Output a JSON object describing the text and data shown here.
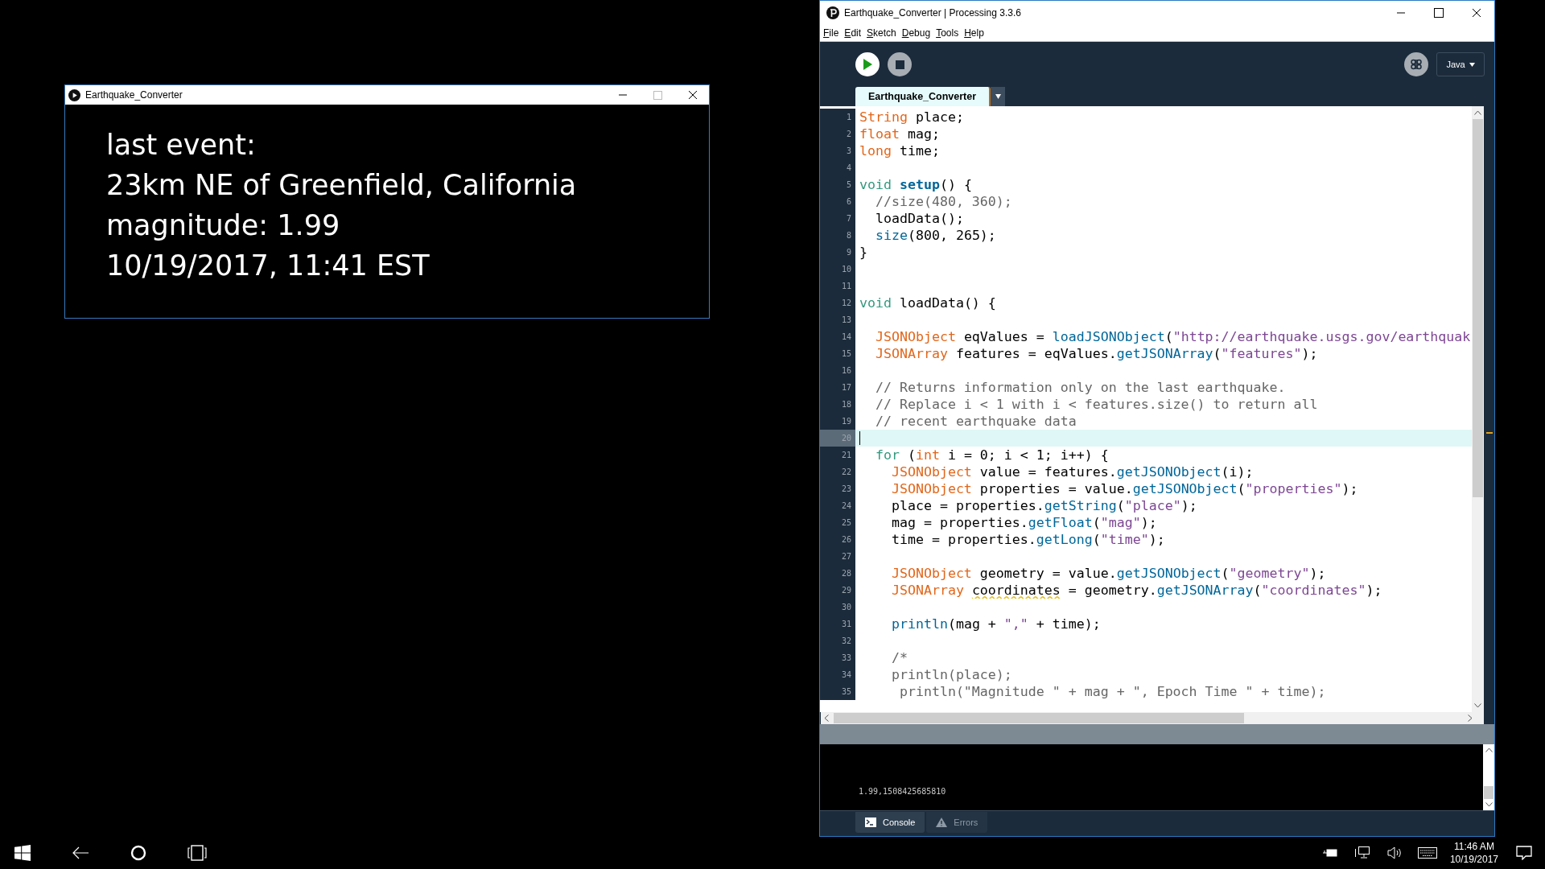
{
  "sketch_window": {
    "title": "Earthquake_Converter",
    "lines": [
      "last event:",
      "23km NE of Greenfield, California",
      "magnitude: 1.99",
      "10/19/2017, 11:41 EST"
    ]
  },
  "ide_window": {
    "title": "Earthquake_Converter | Processing 3.3.6",
    "menu": [
      "File",
      "Edit",
      "Sketch",
      "Debug",
      "Tools",
      "Help"
    ],
    "mode": "Java",
    "tabs": [
      {
        "label": "Earthquake_Converter",
        "selected": true
      }
    ],
    "code": [
      {
        "number": "1",
        "current": false,
        "tokens": [
          {
            "kind": "type",
            "text": "String"
          },
          {
            "kind": "plain",
            "text": " place;"
          }
        ]
      },
      {
        "number": "2",
        "current": false,
        "tokens": [
          {
            "kind": "type",
            "text": "float"
          },
          {
            "kind": "plain",
            "text": " mag;"
          }
        ]
      },
      {
        "number": "3",
        "current": false,
        "tokens": [
          {
            "kind": "type",
            "text": "long"
          },
          {
            "kind": "plain",
            "text": " time;"
          }
        ]
      },
      {
        "number": "4",
        "current": false
      },
      {
        "number": "5",
        "current": false,
        "tokens": [
          {
            "kind": "keyword",
            "text": "void "
          },
          {
            "kind": "function-bold",
            "text": "setup"
          },
          {
            "kind": "plain",
            "text": "() {"
          }
        ]
      },
      {
        "number": "6",
        "current": false,
        "tokens": [
          {
            "kind": "comment",
            "text": "  //size(480, 360);"
          }
        ]
      },
      {
        "number": "7",
        "current": false,
        "tokens": [
          {
            "kind": "plain",
            "text": "  loadData();"
          }
        ]
      },
      {
        "number": "8",
        "current": false,
        "tokens": [
          {
            "kind": "function",
            "text": "  size"
          },
          {
            "kind": "plain",
            "text": "(800, 265);"
          }
        ]
      },
      {
        "number": "9",
        "current": false,
        "tokens": [
          {
            "kind": "plain",
            "text": "}"
          }
        ]
      },
      {
        "number": "10",
        "current": false
      },
      {
        "number": "11",
        "current": false
      },
      {
        "number": "12",
        "current": false,
        "tokens": [
          {
            "kind": "keyword",
            "text": "void"
          },
          {
            "kind": "plain",
            "text": " loadData() {"
          }
        ]
      },
      {
        "number": "13",
        "current": false
      },
      {
        "number": "14",
        "current": false,
        "tokens": [
          {
            "kind": "type",
            "text": "  JSONObject"
          },
          {
            "kind": "plain",
            "text": " eqValues = "
          },
          {
            "kind": "function",
            "text": "loadJSONObject"
          },
          {
            "kind": "plain",
            "text": "("
          },
          {
            "kind": "string",
            "text": "\"http://earthquake.usgs.gov/earthquak"
          }
        ]
      },
      {
        "number": "15",
        "current": false,
        "tokens": [
          {
            "kind": "type",
            "text": "  JSONArray"
          },
          {
            "kind": "plain",
            "text": " features = eqValues."
          },
          {
            "kind": "function",
            "text": "getJSONArray"
          },
          {
            "kind": "plain",
            "text": "("
          },
          {
            "kind": "string",
            "text": "\"features\""
          },
          {
            "kind": "plain",
            "text": ");"
          }
        ]
      },
      {
        "number": "16",
        "current": false
      },
      {
        "number": "17",
        "current": false,
        "tokens": [
          {
            "kind": "comment",
            "text": "  // Returns information only on the last earthquake."
          }
        ]
      },
      {
        "number": "18",
        "current": false,
        "tokens": [
          {
            "kind": "comment",
            "text": "  // Replace i < 1 with i < features.size() to return all"
          }
        ]
      },
      {
        "number": "19",
        "current": false,
        "tokens": [
          {
            "kind": "comment",
            "text": "  // recent earthquake data"
          }
        ]
      },
      {
        "number": "20",
        "current": true
      },
      {
        "number": "21",
        "current": false,
        "tokens": [
          {
            "kind": "keyword",
            "text": "  for"
          },
          {
            "kind": "plain",
            "text": " ("
          },
          {
            "kind": "type",
            "text": "int"
          },
          {
            "kind": "plain",
            "text": " i = 0; i < 1; i++) {"
          }
        ]
      },
      {
        "number": "22",
        "current": false,
        "tokens": [
          {
            "kind": "type",
            "text": "    JSONObject"
          },
          {
            "kind": "plain",
            "text": " value = features."
          },
          {
            "kind": "function",
            "text": "getJSONObject"
          },
          {
            "kind": "plain",
            "text": "(i);"
          }
        ]
      },
      {
        "number": "23",
        "current": false,
        "tokens": [
          {
            "kind": "type",
            "text": "    JSONObject"
          },
          {
            "kind": "plain",
            "text": " properties = value."
          },
          {
            "kind": "function",
            "text": "getJSONObject"
          },
          {
            "kind": "plain",
            "text": "("
          },
          {
            "kind": "string",
            "text": "\"properties\""
          },
          {
            "kind": "plain",
            "text": ");"
          }
        ]
      },
      {
        "number": "24",
        "current": false,
        "tokens": [
          {
            "kind": "plain",
            "text": "    place = properties."
          },
          {
            "kind": "function",
            "text": "getString"
          },
          {
            "kind": "plain",
            "text": "("
          },
          {
            "kind": "string",
            "text": "\"place\""
          },
          {
            "kind": "plain",
            "text": ");"
          }
        ]
      },
      {
        "number": "25",
        "current": false,
        "tokens": [
          {
            "kind": "plain",
            "text": "    mag = properties."
          },
          {
            "kind": "function",
            "text": "getFloat"
          },
          {
            "kind": "plain",
            "text": "("
          },
          {
            "kind": "string",
            "text": "\"mag\""
          },
          {
            "kind": "plain",
            "text": ");"
          }
        ]
      },
      {
        "number": "26",
        "current": false,
        "tokens": [
          {
            "kind": "plain",
            "text": "    time = properties."
          },
          {
            "kind": "function",
            "text": "getLong"
          },
          {
            "kind": "plain",
            "text": "("
          },
          {
            "kind": "string",
            "text": "\"time\""
          },
          {
            "kind": "plain",
            "text": ");"
          }
        ]
      },
      {
        "number": "27",
        "current": false
      },
      {
        "number": "28",
        "current": false,
        "tokens": [
          {
            "kind": "type",
            "text": "    JSONObject"
          },
          {
            "kind": "plain",
            "text": " geometry = value."
          },
          {
            "kind": "function",
            "text": "getJSONObject"
          },
          {
            "kind": "plain",
            "text": "("
          },
          {
            "kind": "string",
            "text": "\"geometry\""
          },
          {
            "kind": "plain",
            "text": ");"
          }
        ]
      },
      {
        "number": "29",
        "current": false,
        "tokens": [
          {
            "kind": "type",
            "text": "    JSONArray "
          },
          {
            "kind": "warning",
            "text": "coordinates"
          },
          {
            "kind": "plain",
            "text": " = geometry."
          },
          {
            "kind": "function",
            "text": "getJSONArray"
          },
          {
            "kind": "plain",
            "text": "("
          },
          {
            "kind": "string",
            "text": "\"coordinates\""
          },
          {
            "kind": "plain",
            "text": ");"
          }
        ]
      },
      {
        "number": "30",
        "current": false
      },
      {
        "number": "31",
        "current": false,
        "tokens": [
          {
            "kind": "function",
            "text": "    println"
          },
          {
            "kind": "plain",
            "text": "(mag + "
          },
          {
            "kind": "string",
            "text": "\",\""
          },
          {
            "kind": "plain",
            "text": " + time);"
          }
        ]
      },
      {
        "number": "32",
        "current": false
      },
      {
        "number": "33",
        "current": false,
        "tokens": [
          {
            "kind": "comment",
            "text": "    /*"
          }
        ]
      },
      {
        "number": "34",
        "current": false,
        "tokens": [
          {
            "kind": "comment",
            "text": "    println(place);"
          }
        ]
      },
      {
        "number": "35",
        "current": false,
        "tokens": [
          {
            "kind": "comment",
            "text": "     println(\"Magnitude \" + mag + \", Epoch Time \" + time);"
          }
        ]
      }
    ],
    "console_output": "1.99,1508425685810",
    "console_tabs": [
      {
        "label": "Console",
        "selected": true
      },
      {
        "label": "Errors",
        "selected": false
      }
    ]
  },
  "taskbar": {
    "time": "11:46 AM",
    "date": "10/19/2017"
  }
}
